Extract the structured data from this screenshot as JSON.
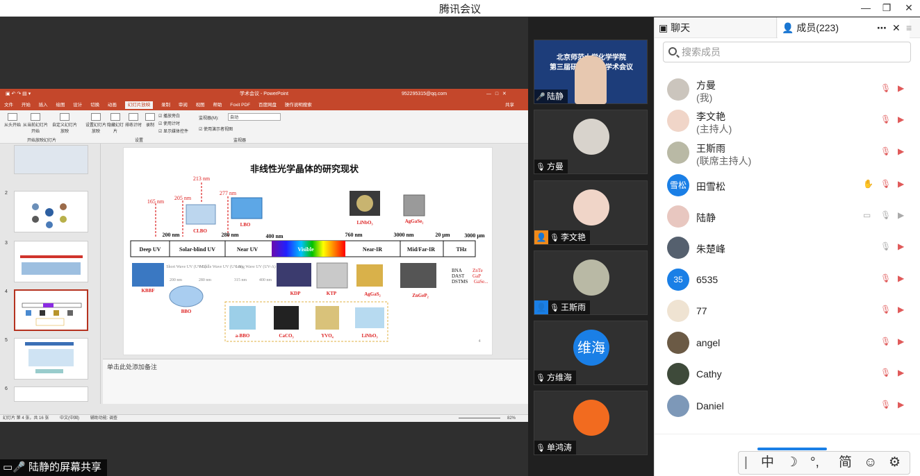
{
  "app": {
    "title": "腾讯会议"
  },
  "share": {
    "label": "陆静的屏幕共享"
  },
  "ppt": {
    "window_title": "学术会议 - PowerPoint",
    "account": "952295315@qq.com",
    "tabs": [
      "文件",
      "开始",
      "插入",
      "绘图",
      "设计",
      "切换",
      "动画",
      "幻灯片放映",
      "录制",
      "审阅",
      "视图",
      "帮助",
      "Foxit PDF",
      "百度网盘",
      "操作说明搜索"
    ],
    "share_label": "共享",
    "ribbon": {
      "from_start": "从头开始",
      "from_current": "从当前幻灯片开始",
      "custom": "自定义幻灯片放映",
      "group_start": "开始放映幻灯片",
      "setup": "设置幻灯片放映",
      "hide": "隐藏幻灯片",
      "rehearse": "排练计时",
      "record": "录制",
      "play_narration": "播放旁白",
      "use_timings": "使用计时",
      "show_media": "显示媒体控件",
      "group_setup": "设置",
      "monitor_label": "监视器(M):",
      "monitor_value": "自动",
      "presenter_view": "使用演示者视图",
      "group_monitor": "监视器"
    },
    "thumb_numbers": [
      "2",
      "3",
      "4",
      "5",
      "6"
    ],
    "notes_placeholder": "单击此处添加备注",
    "status": "幻灯片 第 4 张，共 16 张",
    "status_lang": "中文(中国)",
    "status_access": "辅助功能: 调查",
    "zoom": "82%"
  },
  "slide": {
    "title": "非线性光学晶体的研究现状",
    "page": "4",
    "spectrum": [
      "Deep UV",
      "Solar-blind UV",
      "Near UV",
      "Visible",
      "Near-IR",
      "Mid/Far-IR",
      "THz"
    ],
    "wavelengths": [
      "200 nm",
      "280 nm",
      "400 nm",
      "760 nm",
      "3000 nm",
      "20 μm",
      "3000 μm"
    ],
    "red_marks": [
      "165 nm",
      "205 nm",
      "213 nm",
      "277 nm"
    ],
    "top_crystals": [
      "CLBO",
      "LBO",
      "LiNbO₃",
      "AgGaSe₂"
    ],
    "uv_bands": [
      "Short Wave UV (UV-C)",
      "Middle Wave UV (UV-B)",
      "Long Wave UV (UV-A)"
    ],
    "uv_ticks": [
      "200 nm",
      "280 nm",
      "315 nm",
      "400 nm"
    ],
    "crystals": [
      "KBBF",
      "BBO",
      "KDP",
      "KTP",
      "AgGaS₂",
      "ZnGeP₂"
    ],
    "organics": [
      "BNA",
      "DAST",
      "DSTMS"
    ],
    "semis": [
      "ZnTe",
      "GaP",
      "GaSe..."
    ],
    "box_crystals": [
      "a-BBO",
      "CaCO₃",
      "YVO₄",
      "LiNbO₃"
    ]
  },
  "videos": [
    {
      "name": "陆静",
      "banner1": "北京师范大学化学学院",
      "banner2": "第三届研究生……学术会议"
    },
    {
      "name": "方曼"
    },
    {
      "name": "李文艳"
    },
    {
      "name": "王斯雨"
    },
    {
      "name": "方维海",
      "avatar_text": "维海"
    },
    {
      "name": "单鸿涛"
    }
  ],
  "panel": {
    "tab_chat": "聊天",
    "tab_members": "成员(223)",
    "search_placeholder": "搜索成员",
    "members": [
      {
        "name": "方曼",
        "role": "(我)"
      },
      {
        "name": "李文艳",
        "role": "(主持人)"
      },
      {
        "name": "王斯雨",
        "role": "(联席主持人)"
      },
      {
        "name": "田雪松",
        "avatar_text": "雪松"
      },
      {
        "name": "陆静"
      },
      {
        "name": "朱楚峰"
      },
      {
        "name": "6535",
        "avatar_text": "35"
      },
      {
        "name": "77"
      },
      {
        "name": "angel"
      },
      {
        "name": "Cathy"
      },
      {
        "name": "Daniel"
      }
    ]
  },
  "ime": {
    "mode": "中",
    "punct": "°,",
    "simp": "简"
  },
  "colors": {
    "accent": "#1a7fe6",
    "ppt_red": "#c4472b",
    "muted_red": "#e05a5a"
  }
}
